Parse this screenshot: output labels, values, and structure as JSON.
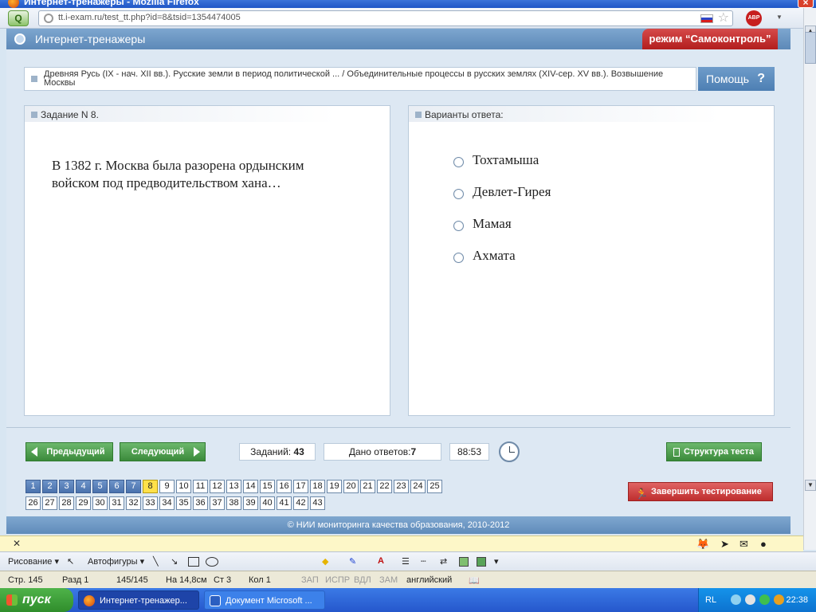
{
  "browser": {
    "title": "Интернет-тренажеры - Mozilla Firefox",
    "url": "tt.i-exam.ru/test_tt.php?id=8&tsid=1354474005",
    "addon": "ABP"
  },
  "site": {
    "name": "Интернет-тренажеры",
    "mode": "режим “Самоконтроль”",
    "topic": "Древняя Русь (IX - нач. XII вв.). Русские земли в период политической ... / Объединительные процессы в русских землях (XIV-сер. XV вв.). Возвышение Москвы",
    "help_label": "Помощь",
    "help_icon": "?"
  },
  "task": {
    "header": "Задание N 8.",
    "question": "В 1382 г. Москва была разорена ордынским войском под предводительством хана…"
  },
  "answers": {
    "header": "Варианты ответа:",
    "options": [
      "Тохтамыша",
      "Девлет-Гирея",
      "Мамая",
      "Ахмата"
    ]
  },
  "controls": {
    "prev_label": "Предыдущий",
    "next_label": "Следующий",
    "structure_label": "Структура теста",
    "finish_label": "Завершить тестирование",
    "total_label": "Заданий:",
    "total_value": "43",
    "answered_label": "Дано ответов:",
    "answered_value": "7",
    "timer": "88:53"
  },
  "question_numbers": {
    "answered": [
      1,
      2,
      3,
      4,
      5,
      6,
      7
    ],
    "current": 8,
    "total": 43
  },
  "footer": "© НИИ мониторинга качества образования, 2010-2012",
  "word_toolbar": {
    "draw_label": "Рисование ▾",
    "autoshapes_label": "Автофигуры ▾"
  },
  "status_bar": {
    "page": "Стр. 145",
    "section": "Разд 1",
    "pages": "145/145",
    "position": "На 14,8см",
    "line": "Ст 3",
    "column": "Кол 1",
    "rec": "ЗАП",
    "trk": "ИСПР",
    "ext": "ВДЛ",
    "ovr": "ЗАМ",
    "lang": "английский"
  },
  "taskbar": {
    "start_label": "пуск",
    "item_firefox": "Интернет-тренажер...",
    "item_word": "Документ Microsoft ...",
    "lang": "RL",
    "clock": "22:38"
  }
}
